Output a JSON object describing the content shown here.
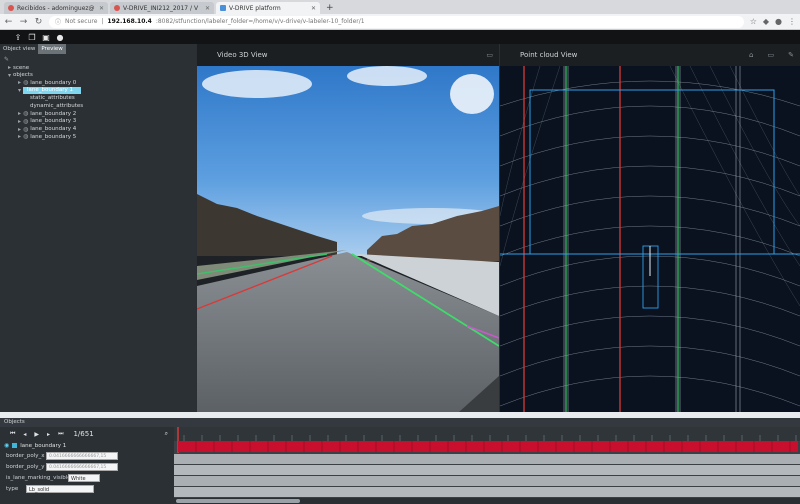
{
  "browser": {
    "tabs": [
      {
        "label": "Recibidos - adominguez@",
        "active": false
      },
      {
        "label": "V-DRIVE_INI212_2017 / V",
        "active": false
      },
      {
        "label": "V-DRIVE platform",
        "active": true
      }
    ],
    "address": {
      "security": "Not secure",
      "host": "192.168.10.4",
      "path": ":8082/stfunction/labeler_folder=/home/v/v-drive/v-labeler-10_folder/1"
    }
  },
  "left_panel": {
    "tabs": [
      "Object view",
      "Preview"
    ],
    "tree": [
      {
        "label": "scene",
        "indent": 1
      },
      {
        "label": "objects",
        "indent": 1
      },
      {
        "label": "lane_boundary 0",
        "indent": 2
      },
      {
        "label": "lane_boundary 1",
        "indent": 2,
        "selected": true
      },
      {
        "label": "static_attributes",
        "indent": 3
      },
      {
        "label": "dynamic_attributes",
        "indent": 3
      },
      {
        "label": "lane_boundary 2",
        "indent": 2
      },
      {
        "label": "lane_boundary 3",
        "indent": 2
      },
      {
        "label": "lane_boundary 4",
        "indent": 2
      },
      {
        "label": "lane_boundary 5",
        "indent": 2
      }
    ]
  },
  "views": {
    "video_title": "Video 3D View",
    "cloud_title": "Point cloud View"
  },
  "bottom": {
    "header": "Objects",
    "frame_counter": "1/651",
    "object_label": "lane_boundary 1",
    "attributes": [
      {
        "key": "border_poly_x",
        "value": "0.0416666666666667,15"
      },
      {
        "key": "border_poly_y",
        "value": "0.0416666666666667,15"
      },
      {
        "key": "is_lane_marking_visible",
        "value": "White"
      },
      {
        "key": "type",
        "value": "Lb_solid"
      }
    ]
  },
  "icons": {
    "toolbar": [
      "upload-icon",
      "copy-icon",
      "save-icon",
      "info-icon"
    ],
    "playback": [
      "first-frame-icon",
      "prev-frame-icon",
      "play-icon",
      "next-frame-icon",
      "last-frame-icon"
    ]
  }
}
